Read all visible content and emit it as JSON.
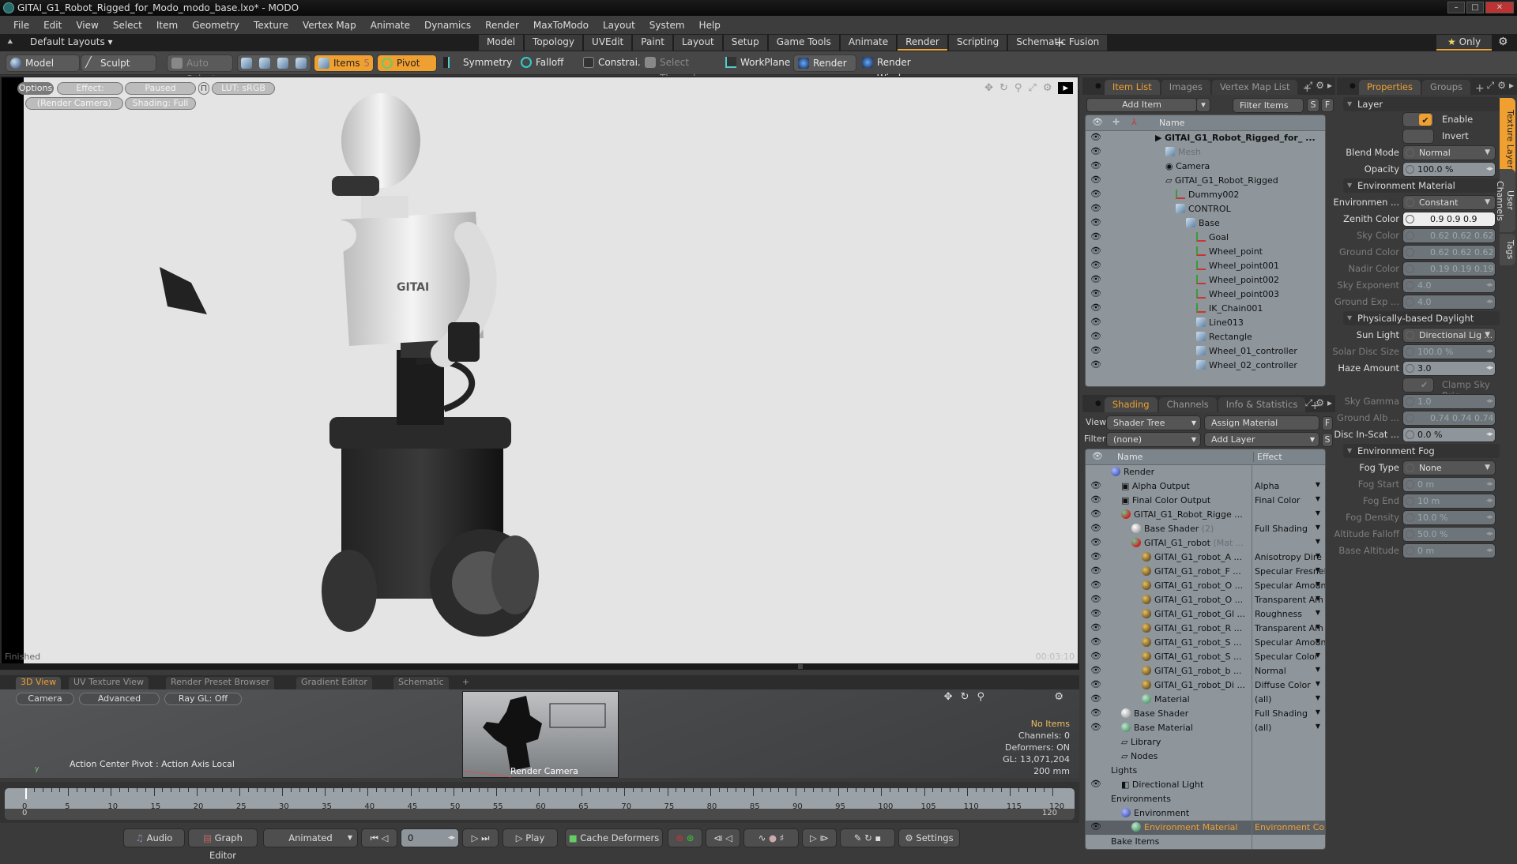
{
  "window": {
    "title": "GITAI_G1_Robot_Rigged_for_Modo_modo_base.lxo* - MODO"
  },
  "menu": [
    "File",
    "Edit",
    "View",
    "Select",
    "Item",
    "Geometry",
    "Texture",
    "Vertex Map",
    "Animate",
    "Dynamics",
    "Render",
    "MaxToModo",
    "Layout",
    "System",
    "Help"
  ],
  "layoutbar": {
    "default_layouts": "Default Layouts ▾",
    "tabs": [
      "Model",
      "Topology",
      "UVEdit",
      "Paint",
      "Layout",
      "Setup",
      "Game Tools",
      "Animate",
      "Render",
      "Scripting",
      "Schematic Fusion"
    ],
    "active_tab": "Render",
    "only_label": "Only"
  },
  "toolbar": {
    "model": "Model",
    "sculpt": "Sculpt",
    "auto_select": "Auto Select",
    "items": "Items",
    "items_badge": "5",
    "pivot": "Pivot",
    "symmetry": "Symmetry",
    "falloff": "Falloff",
    "constraints": "Constrai...",
    "select_through": "Select Through",
    "workplane": "WorkPlane",
    "render": "Render",
    "render_window": "Render Window"
  },
  "viewport": {
    "options": "Options",
    "effect": "Effect: (Shadi...",
    "paused": "Paused",
    "lut": "LUT: sRGB",
    "camera": "(Render Camera)",
    "shading": "Shading: Full",
    "status": "Finished",
    "render_time": "00:03:10"
  },
  "item_list": {
    "tabs": [
      "Item List",
      "Images",
      "Vertex Map List"
    ],
    "add_item": "Add Item",
    "filter_items": "Filter Items",
    "s": "S",
    "f": "F",
    "header_name": "Name",
    "rows": [
      {
        "name": "GITAI_G1_Robot_Rigged_for_ ...",
        "indent": 0,
        "icon": "scene",
        "bold": true
      },
      {
        "name": "Mesh",
        "indent": 1,
        "icon": "mesh",
        "gray": true
      },
      {
        "name": "Camera",
        "indent": 1,
        "icon": "camera"
      },
      {
        "name": "GITAI_G1_Robot_Rigged",
        "indent": 1,
        "icon": "folder"
      },
      {
        "name": "Dummy002",
        "indent": 2,
        "icon": "locator"
      },
      {
        "name": "CONTROL",
        "indent": 2,
        "icon": "mesh"
      },
      {
        "name": "Base",
        "indent": 3,
        "icon": "mesh"
      },
      {
        "name": "Goal",
        "indent": 4,
        "icon": "locator"
      },
      {
        "name": "Wheel_point",
        "indent": 4,
        "icon": "locator"
      },
      {
        "name": "Wheel_point001",
        "indent": 4,
        "icon": "locator"
      },
      {
        "name": "Wheel_point002",
        "indent": 4,
        "icon": "locator"
      },
      {
        "name": "Wheel_point003",
        "indent": 4,
        "icon": "locator"
      },
      {
        "name": "IK_Chain001",
        "indent": 4,
        "icon": "locator"
      },
      {
        "name": "Line013",
        "indent": 4,
        "icon": "mesh"
      },
      {
        "name": "Rectangle",
        "indent": 4,
        "icon": "mesh"
      },
      {
        "name": "Wheel_01_controller",
        "indent": 4,
        "icon": "mesh"
      },
      {
        "name": "Wheel_02_controller",
        "indent": 4,
        "icon": "mesh"
      }
    ]
  },
  "shading": {
    "tabs": [
      "Shading",
      "Channels",
      "Info & Statistics"
    ],
    "view_label": "View",
    "view_value": "Shader Tree",
    "assign_material": "Assign Material",
    "filter_label": "Filter",
    "filter_value": "(none)",
    "add_layer": "Add Layer",
    "f": "F",
    "s": "S",
    "header_name": "Name",
    "header_effect": "Effect",
    "rows": [
      {
        "name": "Render",
        "effect": "",
        "indent": 0,
        "icon": "blueb",
        "eye": false
      },
      {
        "name": "Alpha Output",
        "effect": "Alpha",
        "indent": 1,
        "icon": "img",
        "eye": true
      },
      {
        "name": "Final Color Output",
        "effect": "Final Color",
        "indent": 1,
        "icon": "img",
        "eye": true
      },
      {
        "name": "GITAI_G1_Robot_Rigge ...",
        "effect": "",
        "indent": 1,
        "icon": "redgrn",
        "eye": true
      },
      {
        "name": "Base Shader",
        "suffix": "(2)",
        "effect": "Full Shading",
        "indent": 2,
        "icon": "whiteb",
        "eye": true
      },
      {
        "name": "GITAI_G1_robot",
        "suffix": "(Mat ...",
        "effect": "",
        "indent": 2,
        "icon": "redgrn",
        "eye": true
      },
      {
        "name": "GITAI_G1_robot_A ...",
        "effect": "Anisotropy Dire ...",
        "indent": 3,
        "icon": "gold",
        "eye": true
      },
      {
        "name": "GITAI_G1_robot_F ...",
        "effect": "Specular Fresnel",
        "indent": 3,
        "icon": "gold",
        "eye": true
      },
      {
        "name": "GITAI_G1_robot_O ...",
        "effect": "Specular Amount",
        "indent": 3,
        "icon": "gold",
        "eye": true
      },
      {
        "name": "GITAI_G1_robot_O ...",
        "effect": "Transparent Am ...",
        "indent": 3,
        "icon": "gold",
        "eye": true
      },
      {
        "name": "GITAI_G1_robot_Gl ...",
        "effect": "Roughness",
        "indent": 3,
        "icon": "gold",
        "eye": true
      },
      {
        "name": "GITAI_G1_robot_R ...",
        "effect": "Transparent Am ...",
        "indent": 3,
        "icon": "gold",
        "eye": true
      },
      {
        "name": "GITAI_G1_robot_S ...",
        "effect": "Specular Amount",
        "indent": 3,
        "icon": "gold",
        "eye": true
      },
      {
        "name": "GITAI_G1_robot_S ...",
        "effect": "Specular Color",
        "indent": 3,
        "icon": "gold",
        "eye": true
      },
      {
        "name": "GITAI_G1_robot_b ...",
        "effect": "Normal",
        "indent": 3,
        "icon": "gold",
        "eye": true
      },
      {
        "name": "GITAI_G1_robot_Di ...",
        "effect": "Diffuse Color",
        "indent": 3,
        "icon": "gold",
        "eye": true
      },
      {
        "name": "Material",
        "effect": "(all)",
        "indent": 3,
        "icon": "greenb",
        "eye": true
      },
      {
        "name": "Base Shader",
        "effect": "Full Shading",
        "indent": 1,
        "icon": "whiteb",
        "eye": true
      },
      {
        "name": "Base Material",
        "effect": "(all)",
        "indent": 1,
        "icon": "greenb",
        "eye": true
      },
      {
        "name": "Library",
        "effect": "",
        "indent": 1,
        "icon": "folder",
        "eye": false
      },
      {
        "name": "Nodes",
        "effect": "",
        "indent": 1,
        "icon": "folder",
        "eye": false
      },
      {
        "name": "Lights",
        "effect": "",
        "indent": 0,
        "icon": "none",
        "eye": false
      },
      {
        "name": "Directional Light",
        "effect": "",
        "indent": 1,
        "icon": "light",
        "eye": true
      },
      {
        "name": "Environments",
        "effect": "",
        "indent": 0,
        "icon": "none",
        "eye": false
      },
      {
        "name": "Environment",
        "effect": "",
        "indent": 1,
        "icon": "env",
        "eye": false
      },
      {
        "name": "Environment Material",
        "effect": "Environment Co ...",
        "indent": 2,
        "icon": "greenb",
        "eye": true,
        "selected": true
      },
      {
        "name": "Bake Items",
        "effect": "",
        "indent": 0,
        "icon": "none",
        "eye": false
      }
    ]
  },
  "properties": {
    "tabs": [
      "Properties",
      "Groups"
    ],
    "side_tabs": [
      "Texture Layers",
      "User Channels",
      "Tags"
    ],
    "sections": {
      "layer": "Layer",
      "env_material": "Environment Material",
      "daylight": "Physically-based Daylight",
      "fog": "Environment Fog"
    },
    "enable": "Enable",
    "invert": "Invert",
    "fields": [
      {
        "label": "Blend Mode",
        "value": "Normal",
        "type": "select",
        "dim": false
      },
      {
        "label": "Opacity",
        "value": "100.0 %",
        "type": "num",
        "dim": false
      },
      {
        "label": "Environmen ...",
        "value": "Constant",
        "type": "select",
        "dim": false
      },
      {
        "label": "Zenith Color",
        "value": "0.9   0.9   0.9",
        "type": "white",
        "dim": false
      },
      {
        "label": "Sky Color",
        "value": "0.62 0.62 0.62",
        "type": "color",
        "dim": true
      },
      {
        "label": "Ground Color",
        "value": "0.62 0.62 0.62",
        "type": "color",
        "dim": true
      },
      {
        "label": "Nadir Color",
        "value": "0.19 0.19 0.19",
        "type": "color",
        "dim": true
      },
      {
        "label": "Sky Exponent",
        "value": "4.0",
        "type": "num",
        "dim": true
      },
      {
        "label": "Ground Exp ...",
        "value": "4.0",
        "type": "num",
        "dim": true
      },
      {
        "label": "Sun Light",
        "value": "Directional Lig ...",
        "type": "select",
        "dim": false
      },
      {
        "label": "Solar Disc Size",
        "value": "100.0 %",
        "type": "num",
        "dim": true
      },
      {
        "label": "Haze Amount",
        "value": "3.0",
        "type": "num",
        "dim": false
      },
      {
        "label": "",
        "value": "Clamp Sky Brig...",
        "type": "check",
        "dim": true
      },
      {
        "label": "Sky Gamma",
        "value": "1.0",
        "type": "num",
        "dim": true
      },
      {
        "label": "Ground Alb ...",
        "value": "0.74 0.74 0.74",
        "type": "color",
        "dim": true
      },
      {
        "label": "Disc In-Scat ...",
        "value": "0.0 %",
        "type": "num",
        "dim": false
      },
      {
        "label": "Fog Type",
        "value": "None",
        "type": "select",
        "dim": false
      },
      {
        "label": "Fog Start",
        "value": "0 m",
        "type": "num",
        "dim": true
      },
      {
        "label": "Fog End",
        "value": "10 m",
        "type": "num",
        "dim": true
      },
      {
        "label": "Fog Density",
        "value": "10.0 %",
        "type": "num",
        "dim": true
      },
      {
        "label": "Altitude Falloff",
        "value": "50.0 %",
        "type": "num",
        "dim": true
      },
      {
        "label": "Base Altitude",
        "value": "0 m",
        "type": "num",
        "dim": true
      }
    ]
  },
  "bottom": {
    "tabs": [
      "3D View",
      "UV Texture View",
      "Render Preset Browser",
      "Gradient Editor",
      "Schematic"
    ],
    "camera": "Camera",
    "advanced": "Advanced",
    "raygl": "Ray GL: Off",
    "action_center": "Action Center Pivot : Action Axis Local",
    "render_camera": "Render Camera",
    "stats": {
      "no_items": "No Items",
      "channels": "Channels: 0",
      "deformers": "Deformers: ON",
      "gl": "GL: 13,071,204",
      "scale": "200 mm"
    }
  },
  "timeline": {
    "ticks": [
      0,
      5,
      10,
      15,
      20,
      25,
      30,
      35,
      40,
      45,
      50,
      55,
      60,
      65,
      70,
      75,
      80,
      85,
      90,
      95,
      100,
      105,
      110,
      115,
      120
    ],
    "start": "0",
    "end": "120",
    "current_frame": "0"
  },
  "playbar": {
    "audio": "Audio",
    "graph_editor": "Graph Editor",
    "animated": "Animated",
    "frame": "0",
    "play": "Play",
    "cache_deformers": "Cache Deformers",
    "settings": "Settings"
  },
  "colors": {
    "accent": "#f0a030",
    "panel": "#3a3a3a",
    "list_bg": "#8e969c"
  }
}
